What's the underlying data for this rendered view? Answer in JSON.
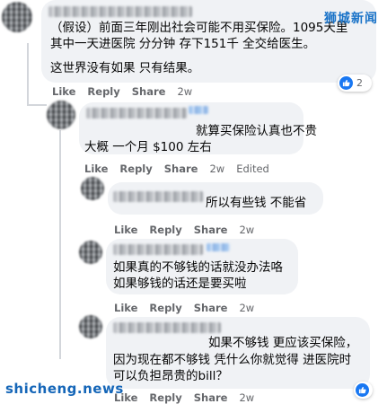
{
  "watermarks": {
    "top_right": "狮城新闻",
    "bottom_left": "shicheng.news"
  },
  "comments": [
    {
      "lines": [
        "（假设）前面三年刚出社会可能不用买保险。1095天里",
        "其中一天进医院 分分钟 存下151千 全交给医生。",
        "",
        "这世界没有如果 只有结果。"
      ],
      "actions": [
        "Like",
        "Reply",
        "Share",
        "2w"
      ],
      "reaction": {
        "type": "like-icon",
        "count": "2"
      }
    },
    {
      "lines": [
        "就算买保险认真也不贵",
        "大概 一个月 $100 左右"
      ],
      "actions": [
        "Like",
        "Reply",
        "Share",
        "2w",
        "Edited"
      ]
    },
    {
      "lines": [
        "所以有些钱 不能省"
      ],
      "actions": [
        "Like",
        "Reply",
        "Share",
        "2w"
      ]
    },
    {
      "lines": [
        "如果真的不够钱的话就没办法咯",
        "如果够钱的话还是要买啦"
      ],
      "actions": [
        "Like",
        "Reply",
        "Share",
        "2w"
      ]
    },
    {
      "lines": [
        "如果不够钱 更应该买保险，",
        "因为现在都不够钱 凭什么你就觉得 进医院时",
        "可以负担昂贵的bill？"
      ],
      "actions": [
        "Like",
        "Reply",
        "Share",
        "2w"
      ],
      "reaction": {
        "type": "like-icon",
        "count": ""
      }
    }
  ]
}
